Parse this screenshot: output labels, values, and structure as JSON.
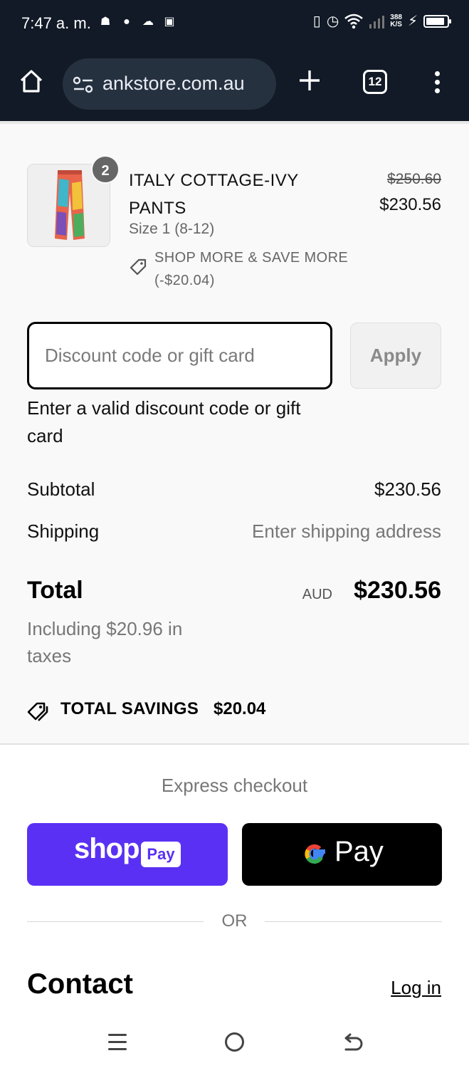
{
  "status_bar": {
    "time": "7:47 a. m.",
    "speed_value": "388",
    "speed_unit": "K/S",
    "battery_level": 0.9,
    "icons": [
      "notification-icons",
      "vibrate-icon",
      "alarm-icon",
      "wifi-icon",
      "signal-icon",
      "charging-icon",
      "battery-icon"
    ]
  },
  "browser": {
    "url": "ankstore.com.au",
    "tab_count": "12"
  },
  "cart": {
    "item": {
      "quantity": "2",
      "name": "ITALY COTTAGE-IVY PANTS",
      "variant": "Size 1 (8-12)",
      "price_original": "$250.60",
      "price_current": "$230.56",
      "promo": "SHOP MORE & SAVE MORE (-$20.04)"
    }
  },
  "discount": {
    "placeholder": "Discount code or gift card",
    "apply_label": "Apply",
    "error": "Enter a valid discount code or gift card"
  },
  "totals": {
    "subtotal_label": "Subtotal",
    "subtotal_value": "$230.56",
    "shipping_label": "Shipping",
    "shipping_value": "Enter shipping address",
    "total_label": "Total",
    "currency": "AUD",
    "total_value": "$230.56",
    "tax_note": "Including $20.96 in taxes",
    "savings_label": "TOTAL SAVINGS",
    "savings_value": "$20.04"
  },
  "express": {
    "title": "Express checkout",
    "shop_word": "shop",
    "shop_pay_chip": "Pay",
    "gpay_word": "Pay",
    "or_text": "OR",
    "brand_colors": {
      "shop_pay": "#5a31f4",
      "google_pay_bg": "#000000"
    }
  },
  "contact": {
    "title": "Contact",
    "login": "Log in"
  }
}
